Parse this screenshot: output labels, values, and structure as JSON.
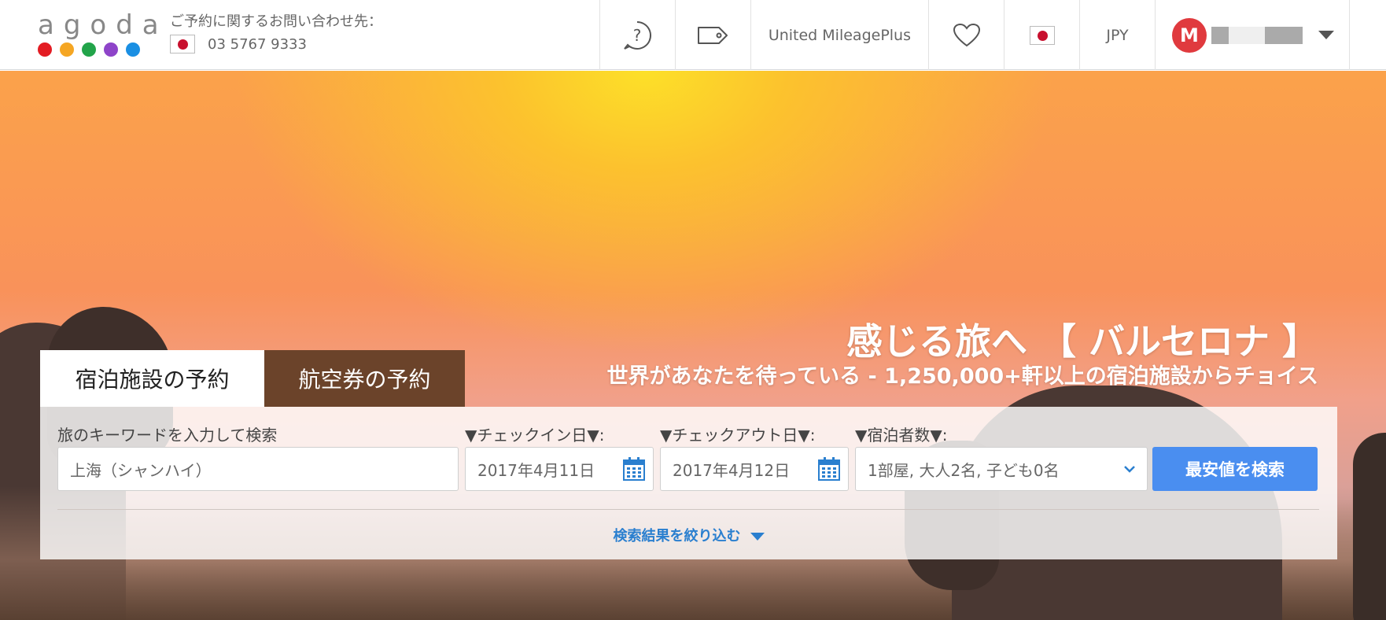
{
  "header": {
    "logo_text": "agoda",
    "logo_dot_colors": [
      "#e31c23",
      "#f5a623",
      "#22a44a",
      "#8e44c9",
      "#1a8fe3"
    ],
    "contact_label": "ご予約に関するお問い合わせ先：",
    "contact_phone": "03 5767 9333",
    "nav": {
      "help_icon": "question-circle-icon",
      "deals_icon": "price-tag-icon",
      "mileage_label": "United MileagePlus",
      "favorites_icon": "heart-icon",
      "language_icon": "japan-flag-icon",
      "currency_label": "JPY",
      "avatar_initial": "M"
    }
  },
  "hero": {
    "headline": "感じる旅へ 【 バルセロナ 】",
    "subheadline": "世界があなたを待っている - 1,250,000+軒以上の宿泊施設からチョイス"
  },
  "tabs": [
    {
      "label": "宿泊施設の予約",
      "active": true
    },
    {
      "label": "航空券の予約",
      "active": false
    }
  ],
  "search": {
    "keyword_label": "旅のキーワードを入力して検索",
    "keyword_value": "上海（シャンハイ）",
    "checkin_label": "▼チェックイン日▼:",
    "checkin_value": "2017年4月11日",
    "checkout_label": "▼チェックアウト日▼:",
    "checkout_value": "2017年4月12日",
    "guests_label": "▼宿泊者数▼:",
    "guests_value": "1部屋, 大人2名, 子ども0名",
    "submit_label": "最安値を検索",
    "refine_label": "検索結果を絞り込む"
  },
  "colors": {
    "accent_blue": "#4a8ef0",
    "link_blue": "#2a7fcf",
    "tab_brown": "#6b432a",
    "avatar_red": "#e03a3e"
  }
}
